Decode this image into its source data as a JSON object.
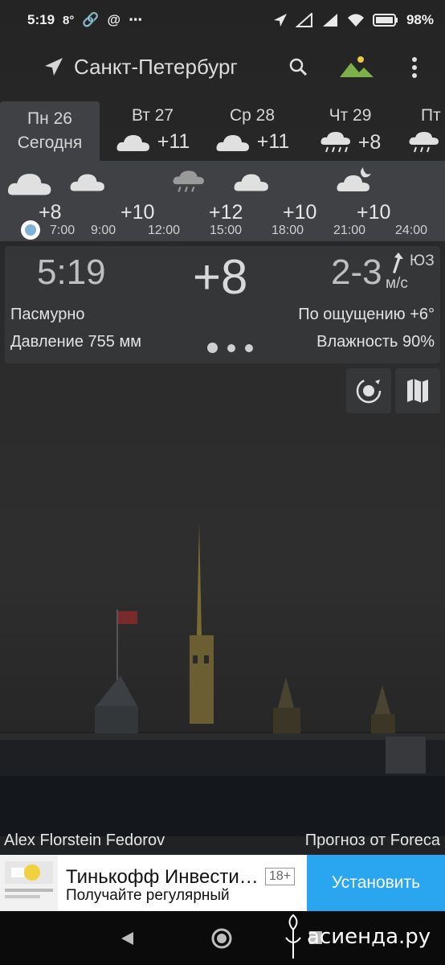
{
  "status_bar": {
    "time": "5:19",
    "temp_indicator": "8°",
    "battery": "98%",
    "icons": [
      "link-icon",
      "at-icon",
      "more-dots-icon",
      "location-arrow-icon",
      "signal-icon",
      "signal-icon",
      "wifi-icon",
      "battery-icon"
    ]
  },
  "header": {
    "city": "Санкт-Петербург",
    "icons": [
      "location-arrow-icon",
      "search-icon",
      "photo-landscape-icon",
      "overflow-menu-icon"
    ]
  },
  "days": [
    {
      "name": "Пн 26",
      "sub": "Сегодня",
      "active": true
    },
    {
      "name": "Вт 27",
      "temp": "+11",
      "icon": "cloud-icon"
    },
    {
      "name": "Ср 28",
      "temp": "+11",
      "icon": "cloud-icon"
    },
    {
      "name": "Чт 29",
      "temp": "+8",
      "icon": "rain-cloud-icon"
    },
    {
      "name": "Пт",
      "icon": "rain-cloud-icon"
    }
  ],
  "hourly": {
    "temps": [
      "+8",
      "+10",
      "+12",
      "+10",
      "+10"
    ],
    "hours": [
      "7:00",
      "9:00",
      "12:00",
      "15:00",
      "18:00",
      "21:00",
      "24:00"
    ],
    "icons": [
      "cloud-icon",
      "cloud-icon",
      "rain-cloud-icon",
      "cloud-icon",
      "night-cloud-icon"
    ]
  },
  "current": {
    "time": "5:19",
    "temp": "+8",
    "wind_speed": "2-3",
    "wind_dir": "ЮЗ",
    "wind_unit": "м/с",
    "condition": "Пасмурно",
    "feels_like": "По ощущению +6°",
    "pressure": "Давление 755 мм",
    "humidity": "Влажность 90%"
  },
  "side_buttons": [
    "sun-cycle-icon",
    "map-icon"
  ],
  "credits": {
    "photo": "Alex Florstein Fedorov",
    "forecast": "Прогноз от Foreca"
  },
  "ad": {
    "title": "Тинькофф Инвести…",
    "age": "18+",
    "subtitle": "Получайте регулярный",
    "button": "Установить"
  },
  "navbar": {
    "icons": [
      "back-icon",
      "home-icon",
      "recents-icon"
    ]
  },
  "watermark": "асиенда.ру",
  "colors": {
    "accent_blue": "#2aa5f0",
    "now_dot": "#7fb2d6",
    "panel": "#3f4144"
  }
}
